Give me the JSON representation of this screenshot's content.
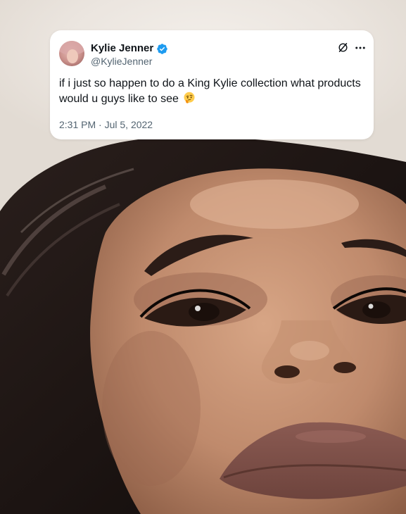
{
  "tweet": {
    "display_name": "Kylie Jenner",
    "handle": "@KylieJenner",
    "text": "if i just so happen to do a King Kylie collection what products would u guys like to see",
    "emoji": "thinking-face",
    "time": "2:31 PM",
    "separator": "·",
    "date": "Jul 5, 2022",
    "verified": true,
    "verified_color": "#1d9bf0"
  },
  "icons": {
    "brand": "x-logo-icon",
    "more": "more-options-icon",
    "verified": "verified-badge-icon",
    "emoji": "thinking-face-emoji"
  }
}
